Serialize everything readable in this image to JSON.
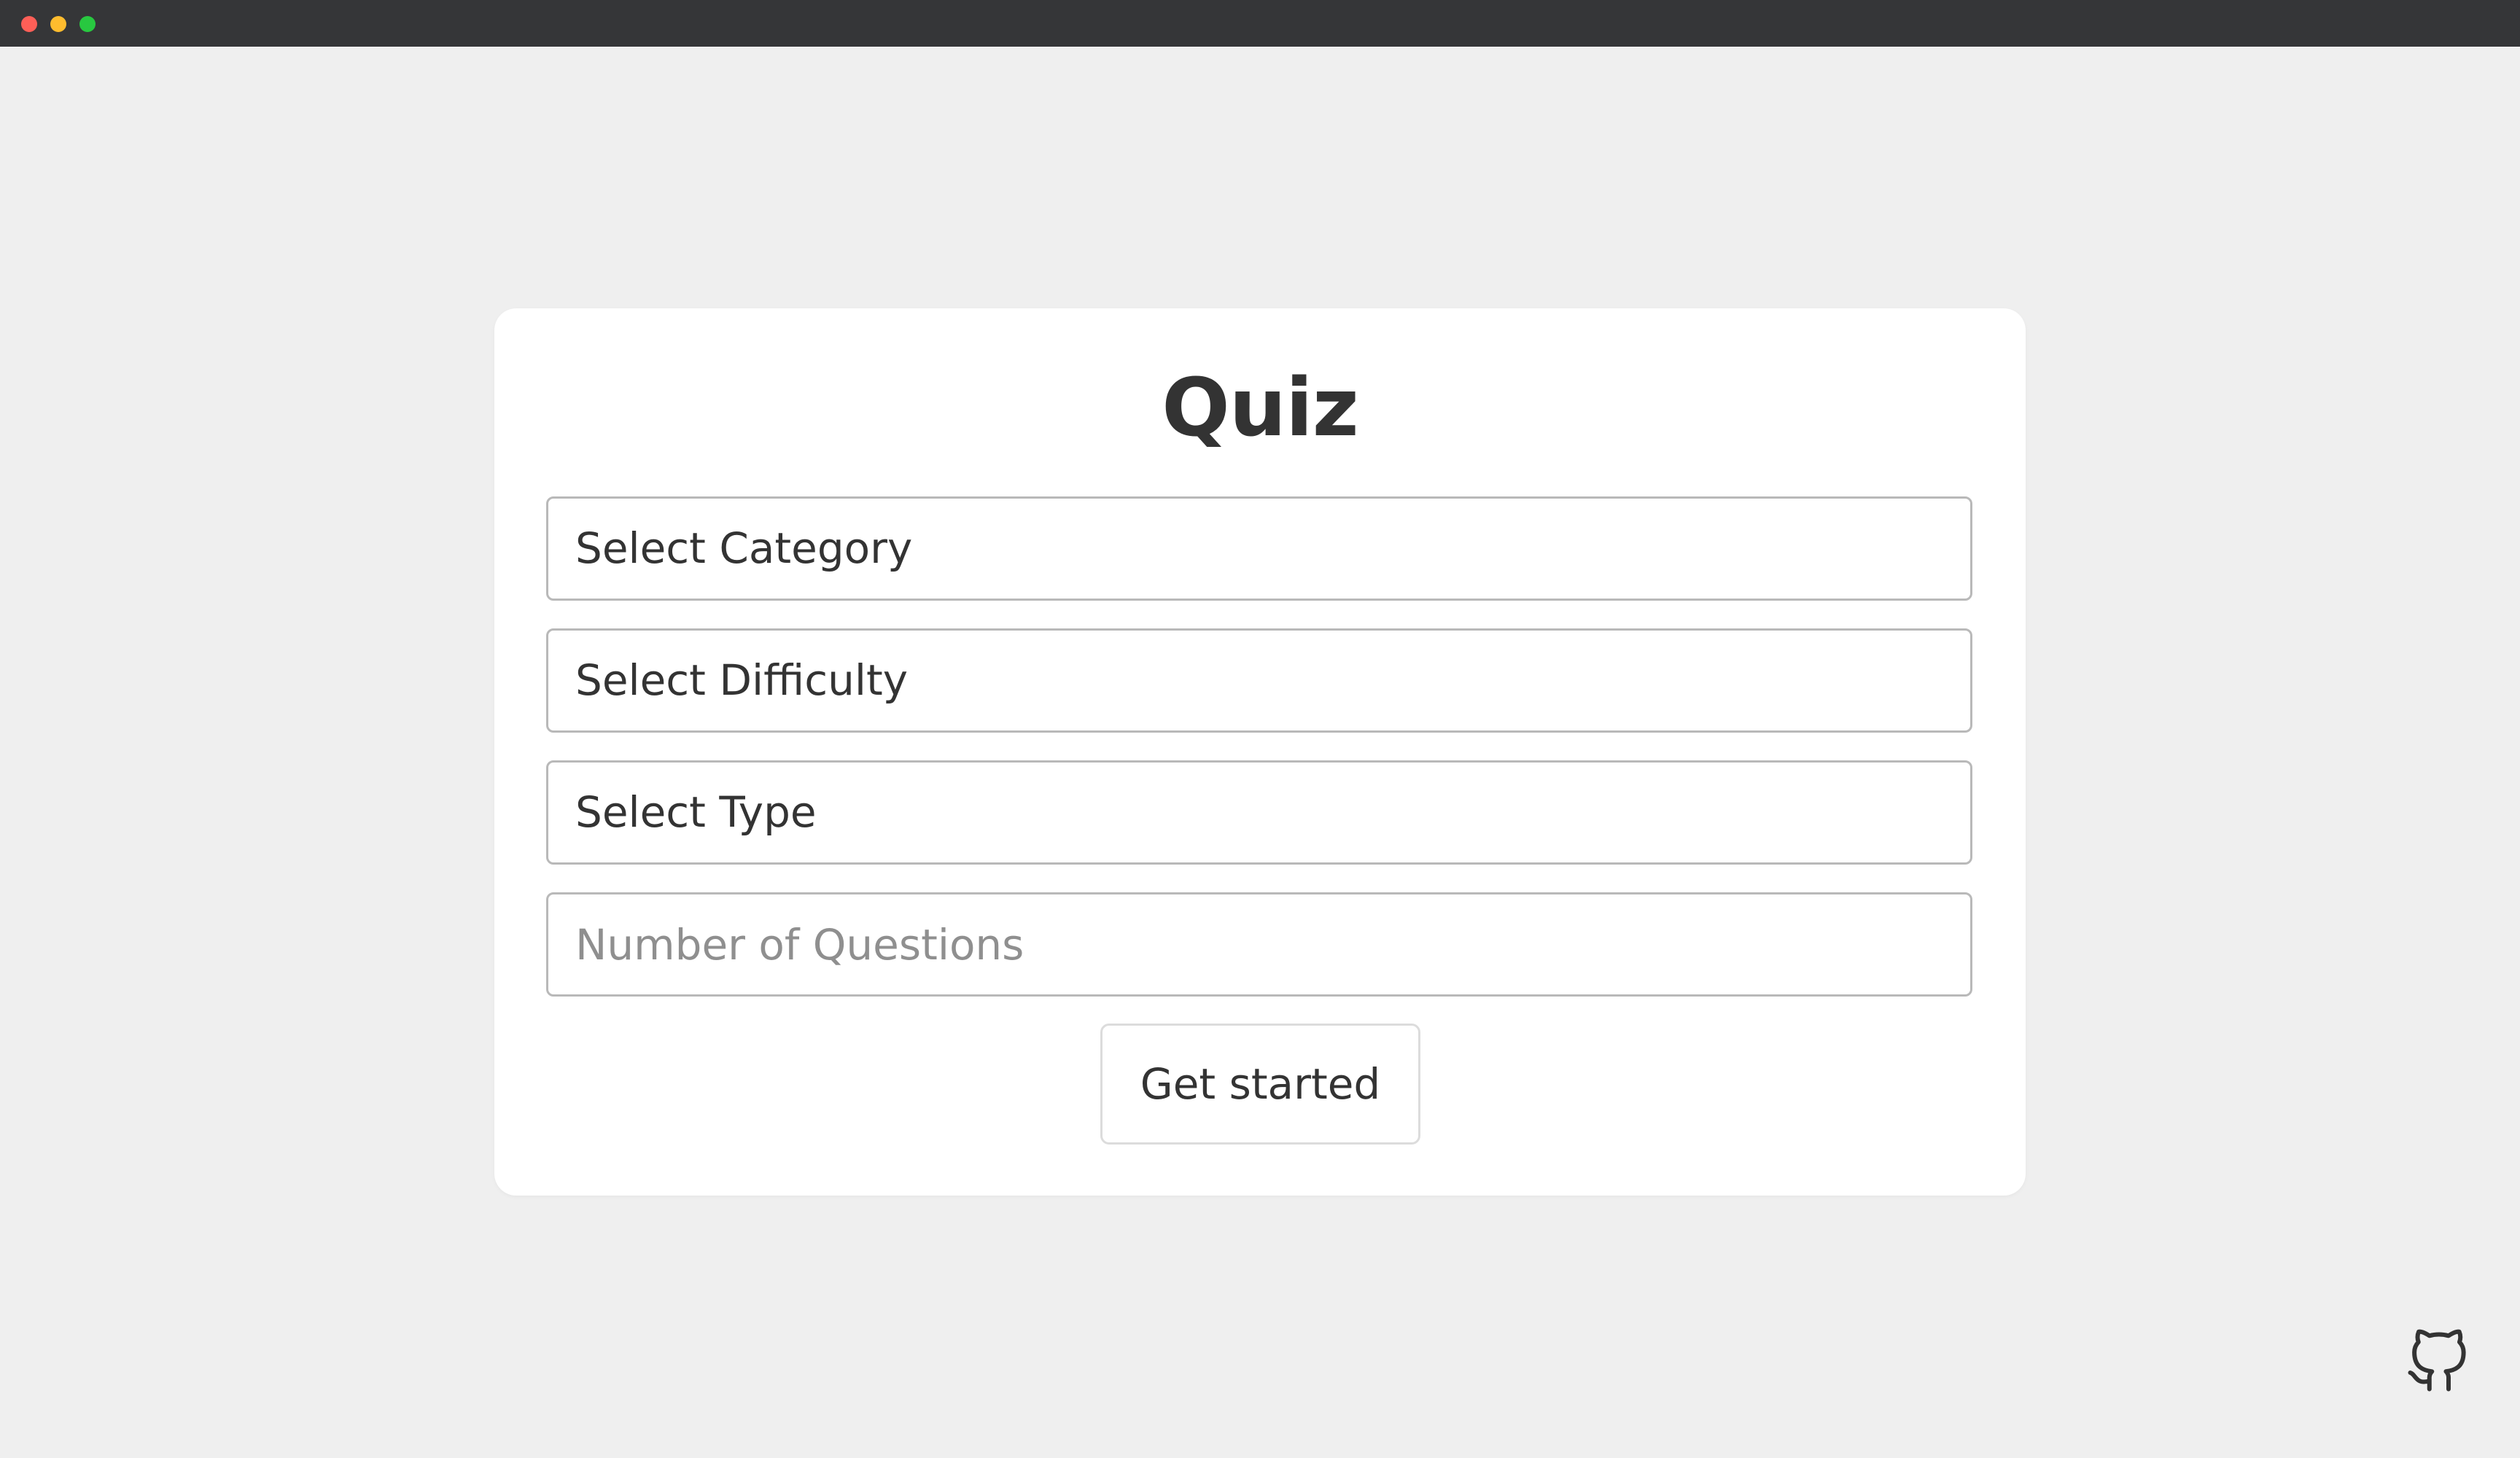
{
  "quiz": {
    "title": "Quiz",
    "category": {
      "selected": "Select Category"
    },
    "difficulty": {
      "selected": "Select Difficulty"
    },
    "type": {
      "selected": "Select Type"
    },
    "questions": {
      "placeholder": "Number of Questions",
      "value": ""
    },
    "start_label": "Get started"
  },
  "icons": {
    "github": "github-icon",
    "window_close": "close-dot",
    "window_minimize": "minimize-dot",
    "window_zoom": "zoom-dot"
  },
  "colors": {
    "background": "#efefef",
    "titlebar": "#353638",
    "card": "#ffffff",
    "text": "#333333",
    "field_border": "#b9b9b9",
    "placeholder": "#8f8f8f"
  }
}
